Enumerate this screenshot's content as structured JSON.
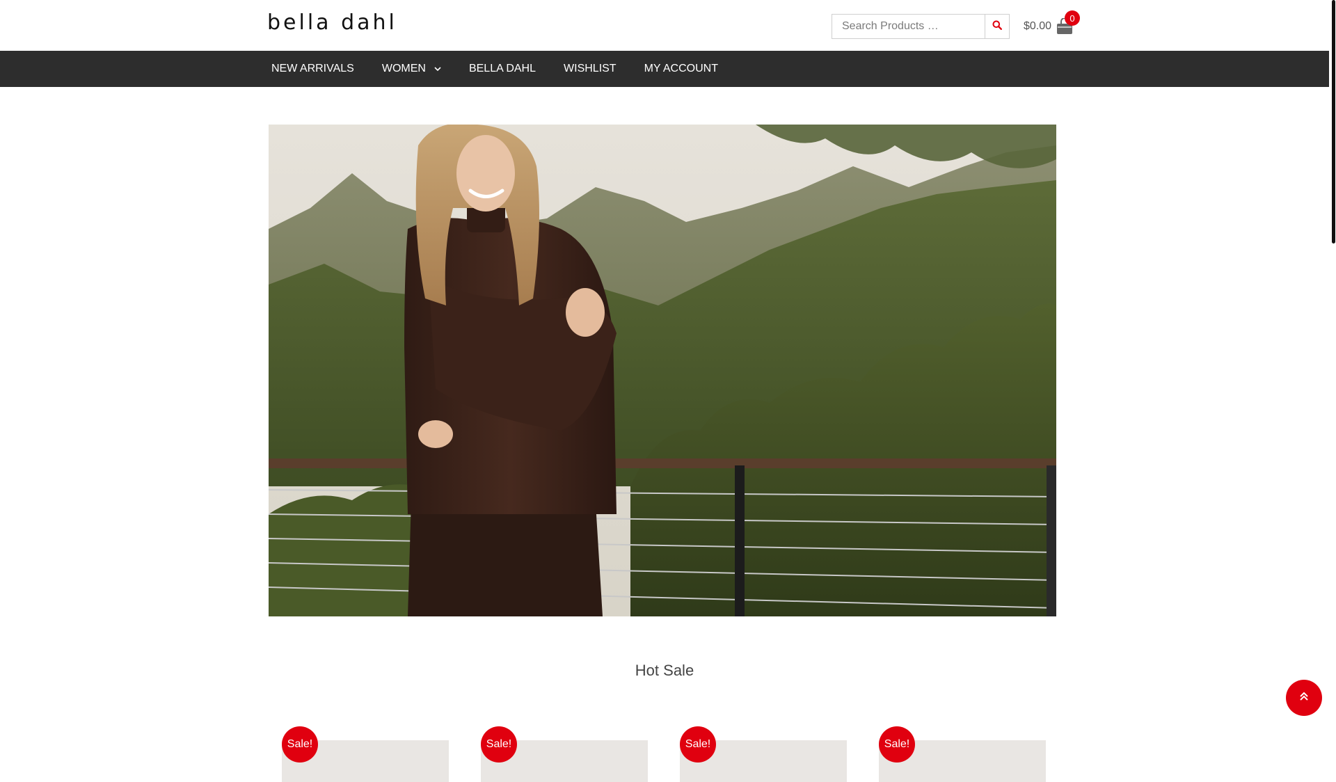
{
  "header": {
    "logo_text": "bella dahl",
    "search": {
      "placeholder": "Search Products …",
      "value": ""
    },
    "cart": {
      "total": "$0.00",
      "count": "0"
    }
  },
  "nav": {
    "items": [
      {
        "label": "NEW ARRIVALS"
      },
      {
        "label": "WOMEN",
        "has_dropdown": true
      },
      {
        "label": "BELLA DAHL"
      },
      {
        "label": "WISHLIST"
      },
      {
        "label": "MY ACCOUNT"
      }
    ]
  },
  "hot_sale": {
    "title": "Hot Sale",
    "products": [
      {
        "badge": "Sale!"
      },
      {
        "badge": "Sale!"
      },
      {
        "badge": "Sale!"
      },
      {
        "badge": "Sale!"
      }
    ]
  },
  "colors": {
    "accent": "#e0000f",
    "nav_bg": "#2d2d2d",
    "nav_text": "#ffffff"
  },
  "icons": {
    "search": "search-icon",
    "cart": "shopping-bag-icon",
    "dropdown": "chevron-down-icon",
    "back_to_top": "double-chevron-up-icon"
  }
}
